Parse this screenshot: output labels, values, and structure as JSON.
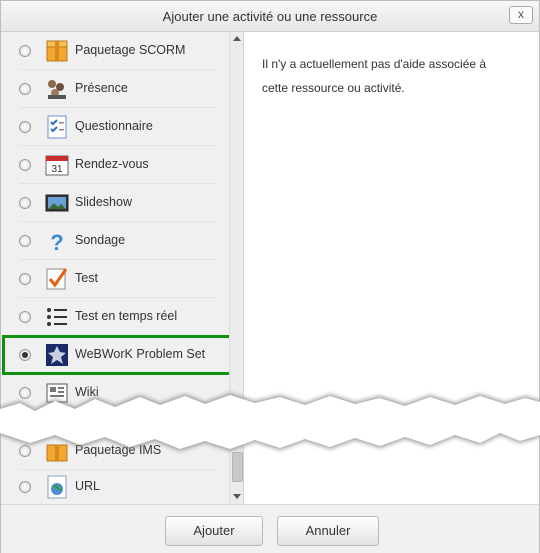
{
  "dialog": {
    "title": "Ajouter une activité ou une ressource",
    "close_label": "x"
  },
  "items": [
    {
      "label": "Paquetage SCORM",
      "icon": "scorm-package-icon",
      "selected": false
    },
    {
      "label": "Présence",
      "icon": "attendance-icon",
      "selected": false
    },
    {
      "label": "Questionnaire",
      "icon": "questionnaire-icon",
      "selected": false
    },
    {
      "label": "Rendez-vous",
      "icon": "calendar-icon",
      "selected": false
    },
    {
      "label": "Slideshow",
      "icon": "slideshow-icon",
      "selected": false
    },
    {
      "label": "Sondage",
      "icon": "question-mark-icon",
      "selected": false
    },
    {
      "label": "Test",
      "icon": "checkmark-icon",
      "selected": false
    },
    {
      "label": "Test en temps réel",
      "icon": "list-icon",
      "selected": false
    },
    {
      "label": "WeBWorK Problem Set",
      "icon": "webwork-icon",
      "selected": true
    },
    {
      "label": "Wiki",
      "icon": "wiki-icon",
      "selected": false
    },
    {
      "label": "Paquetage IMS",
      "icon": "ims-package-icon",
      "selected": false
    },
    {
      "label": "URL",
      "icon": "url-icon",
      "selected": false
    }
  ],
  "help": {
    "text": "Il n'y a actuellement pas d'aide associée à cette ressource ou activité."
  },
  "footer": {
    "add_label": "Ajouter",
    "cancel_label": "Annuler"
  },
  "colors": {
    "highlight": "#109010"
  }
}
